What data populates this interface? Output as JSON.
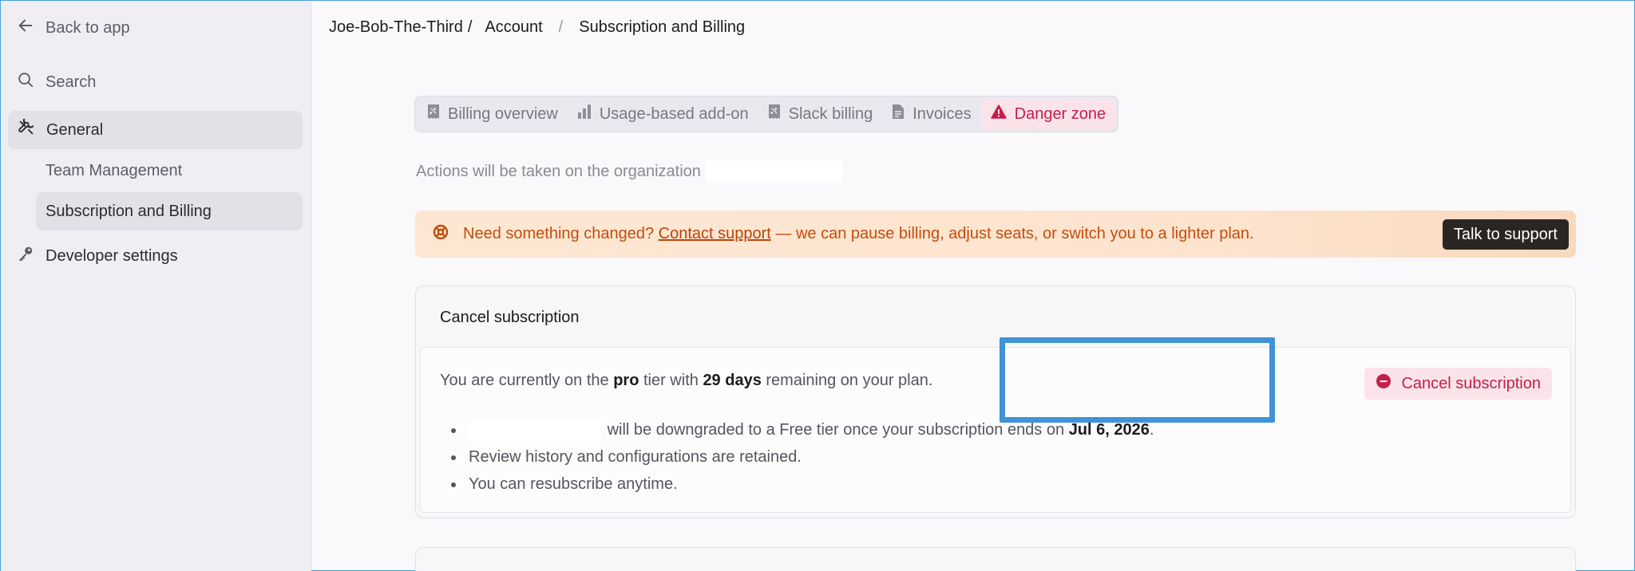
{
  "sidebar": {
    "back_label": "Back to app",
    "search_label": "Search",
    "general_label": "General",
    "team_label": "Team Management",
    "billing_label": "Subscription and Billing",
    "developer_label": "Developer settings"
  },
  "breadcrumb": {
    "org": "Joe-Bob-The-Third",
    "sep1": "/",
    "account": "Account",
    "sep2": "/",
    "page": "Subscription and Billing"
  },
  "tabs": [
    {
      "label": "Billing overview",
      "icon": "receipt-icon"
    },
    {
      "label": "Usage-based add-on",
      "icon": "bar-chart-icon"
    },
    {
      "label": "Slack billing",
      "icon": "receipt-icon"
    },
    {
      "label": "Invoices",
      "icon": "document-icon"
    },
    {
      "label": "Danger zone",
      "icon": "warning-icon",
      "active": true
    }
  ],
  "org_note": "Actions will be taken on the organization",
  "banner": {
    "prefix": "Need something changed?",
    "link": "Contact support",
    "suffix": "— we can pause billing, adjust seats, or switch you to a lighter plan.",
    "button": "Talk to support"
  },
  "cancel_card": {
    "title": "Cancel subscription",
    "summary": {
      "t1": "You are currently on the",
      "tier": "pro",
      "t2": "tier with",
      "days": "29 days",
      "t3": "remaining on your plan."
    },
    "bullets": {
      "b1_text": "will be downgraded to a Free tier once your subscription ends on",
      "b1_date": "Jul 6, 2026",
      "b1_end": ".",
      "b2": "Review history and configurations are retained.",
      "b3": "You can resubscribe anytime."
    },
    "button": "Cancel subscription"
  },
  "colors": {
    "accent_danger": "#c41e4a",
    "banner_text": "#c44d0c",
    "highlight": "#3f93d6"
  }
}
